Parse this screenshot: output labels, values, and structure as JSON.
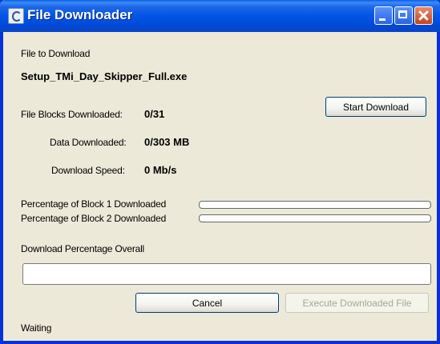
{
  "window": {
    "title": "File Downloader"
  },
  "file": {
    "section_label": "File to Download",
    "name": "Setup_TMi_Day_Skipper_Full.exe"
  },
  "stats": {
    "blocks_label": "File Blocks Downloaded:",
    "blocks_value": "0/31",
    "data_label": "Data Downloaded:",
    "data_value": "0/303 MB",
    "speed_label": "Download Speed:",
    "speed_value": "0 Mb/s"
  },
  "buttons": {
    "start_download": "Start Download",
    "cancel": "Cancel",
    "execute": "Execute Downloaded File"
  },
  "progress": {
    "block1_label": "Percentage of Block 1 Downloaded",
    "block1_value": 0,
    "block2_label": "Percentage of Block 2 Downloaded",
    "block2_value": 0,
    "overall_label": "Download  Percentage Overall",
    "overall_value": 0
  },
  "status": {
    "text": "Waiting"
  },
  "colors": {
    "title_bar": "#0055e5",
    "window_bg": "#ece9d8",
    "progress_fill": "#2fb12f"
  },
  "icons": {
    "app": "app-icon",
    "minimize": "minimize-icon",
    "maximize": "maximize-icon",
    "close": "close-icon"
  }
}
